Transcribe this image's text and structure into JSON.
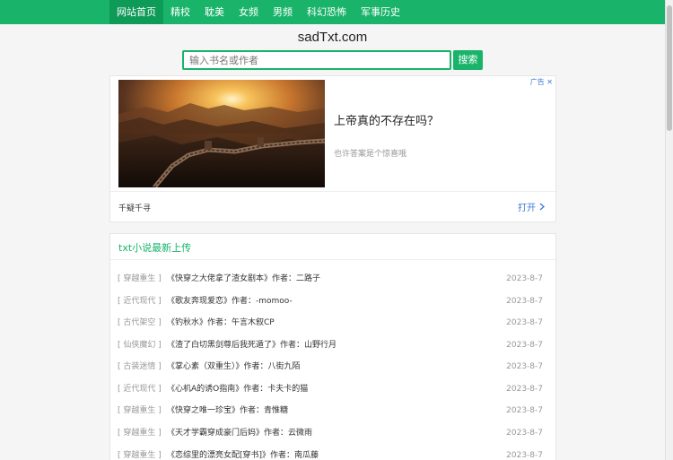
{
  "nav": {
    "items": [
      {
        "label": "网站首页",
        "active": true
      },
      {
        "label": "精校",
        "active": false
      },
      {
        "label": "耽美",
        "active": false
      },
      {
        "label": "女频",
        "active": false
      },
      {
        "label": "男频",
        "active": false
      },
      {
        "label": "科幻恐怖",
        "active": false
      },
      {
        "label": "军事历史",
        "active": false
      }
    ]
  },
  "site": {
    "title": "sadTxt.com"
  },
  "search": {
    "placeholder": "输入书名或作者",
    "value": "",
    "button_label": "搜索"
  },
  "ad": {
    "badge": "广告",
    "headline": "上帝真的不存在吗？",
    "description": "也许答案是个惊喜哦",
    "source": "千疑千寻",
    "open_label": "打开"
  },
  "latest": {
    "title": "txt小说最新上传",
    "rows": [
      {
        "category": "[ 穿越重生 ]",
        "book": "《快穿之大佬拿了渣女剧本》作者：二路子",
        "date": "2023-8-7"
      },
      {
        "category": "[ 近代现代 ]",
        "book": "《歌友奔现爱恋》作者：-momoo-",
        "date": "2023-8-7"
      },
      {
        "category": "[ 古代架空 ]",
        "book": "《钓秋水》作者：午言木叙CP",
        "date": "2023-8-7"
      },
      {
        "category": "[ 仙侠魔幻 ]",
        "book": "《渣了白切黑剑尊后我死遁了》作者：山野行月",
        "date": "2023-8-7"
      },
      {
        "category": "[ 古装迷情 ]",
        "book": "《掌心素（双重生）》作者：八街九陌",
        "date": "2023-8-7"
      },
      {
        "category": "[ 近代现代 ]",
        "book": "《心机A的诱O指南》作者：卡夫卡的猫",
        "date": "2023-8-7"
      },
      {
        "category": "[ 穿越重生 ]",
        "book": "《快穿之唯一珍宝》作者：青惟糖",
        "date": "2023-8-7"
      },
      {
        "category": "[ 穿越重生 ]",
        "book": "《天才学霸穿成豪门后妈》作者：云微雨",
        "date": "2023-8-7"
      },
      {
        "category": "[ 穿越重生 ]",
        "book": "《恋综里的漂亮女配[穿书]》作者：南瓜藤",
        "date": "2023-8-7"
      }
    ]
  },
  "colors": {
    "brand": "#19b46a",
    "link": "#3a7bd5"
  }
}
